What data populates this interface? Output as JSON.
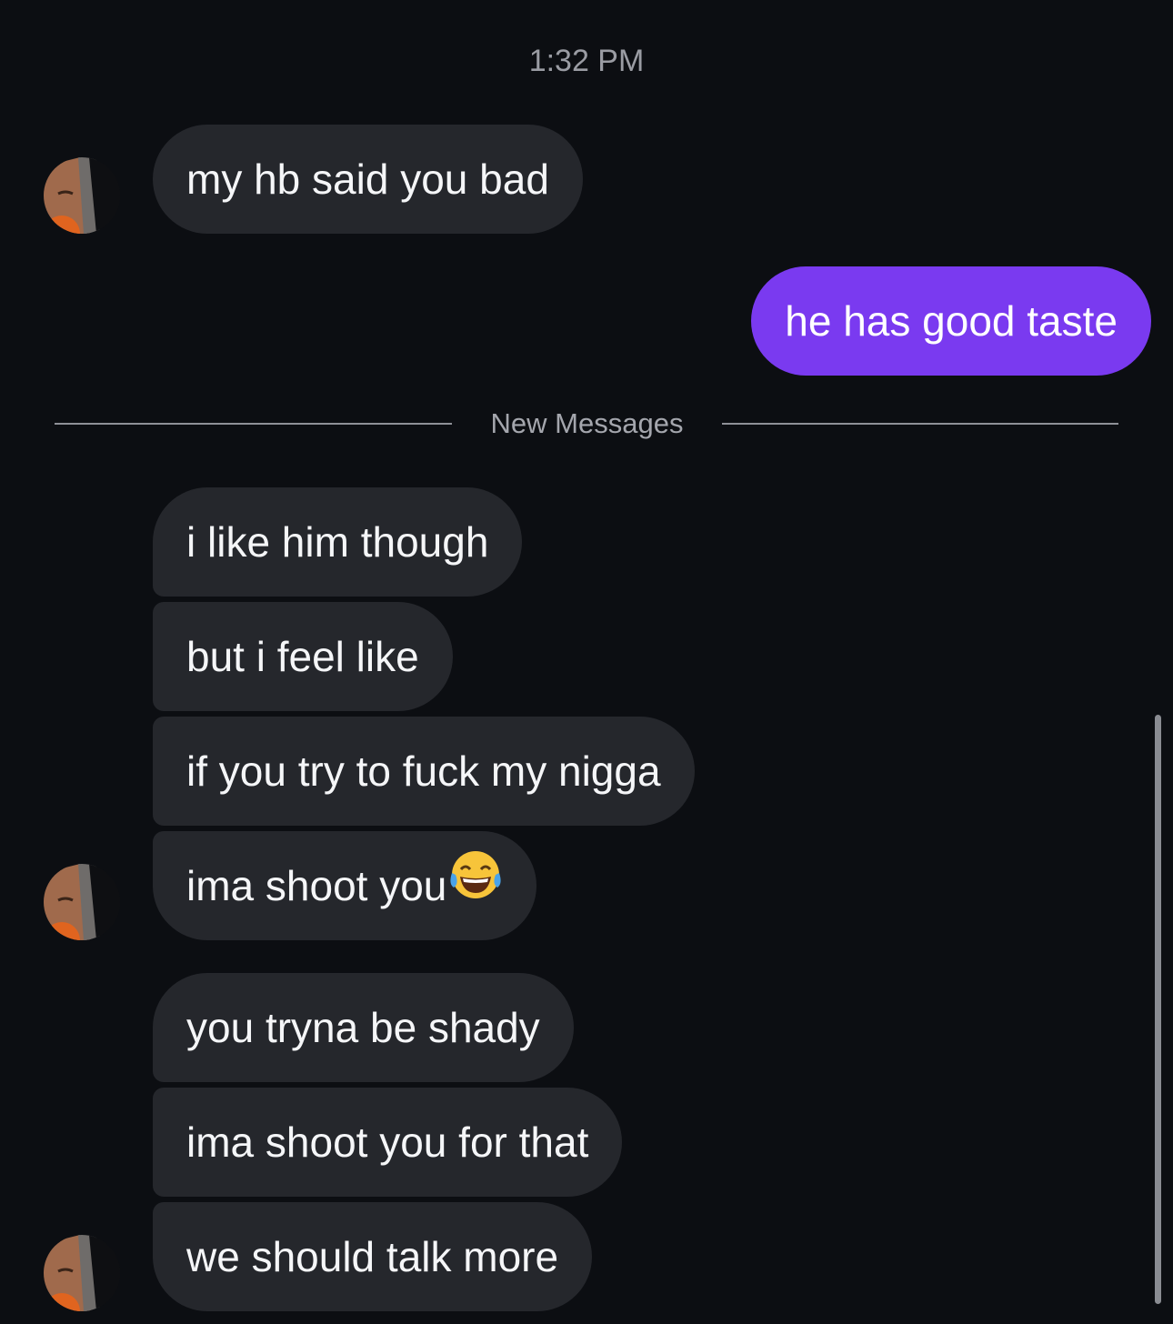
{
  "timestamp": "1:32 PM",
  "divider_label": "New Messages",
  "messages": [
    {
      "text": "my hb said you bad",
      "from": "them"
    },
    {
      "text": "he has good taste",
      "from": "me"
    },
    {
      "text": "i like him though",
      "from": "them"
    },
    {
      "text": "but i feel like",
      "from": "them"
    },
    {
      "text": "if you try to fuck my nigga",
      "from": "them"
    },
    {
      "text": "ima shoot you",
      "from": "them",
      "emoji": "face-with-tears-of-joy-icon"
    },
    {
      "text": "you tryna be shady",
      "from": "them"
    },
    {
      "text": "ima shoot you for that",
      "from": "them"
    },
    {
      "text": "we should talk more",
      "from": "them"
    }
  ],
  "colors": {
    "background": "#0c0e12",
    "incoming_bubble": "#25272c",
    "outgoing_bubble": "#7a3af0",
    "timestamp_text": "#9a9ca3",
    "divider": "#8e9097"
  }
}
